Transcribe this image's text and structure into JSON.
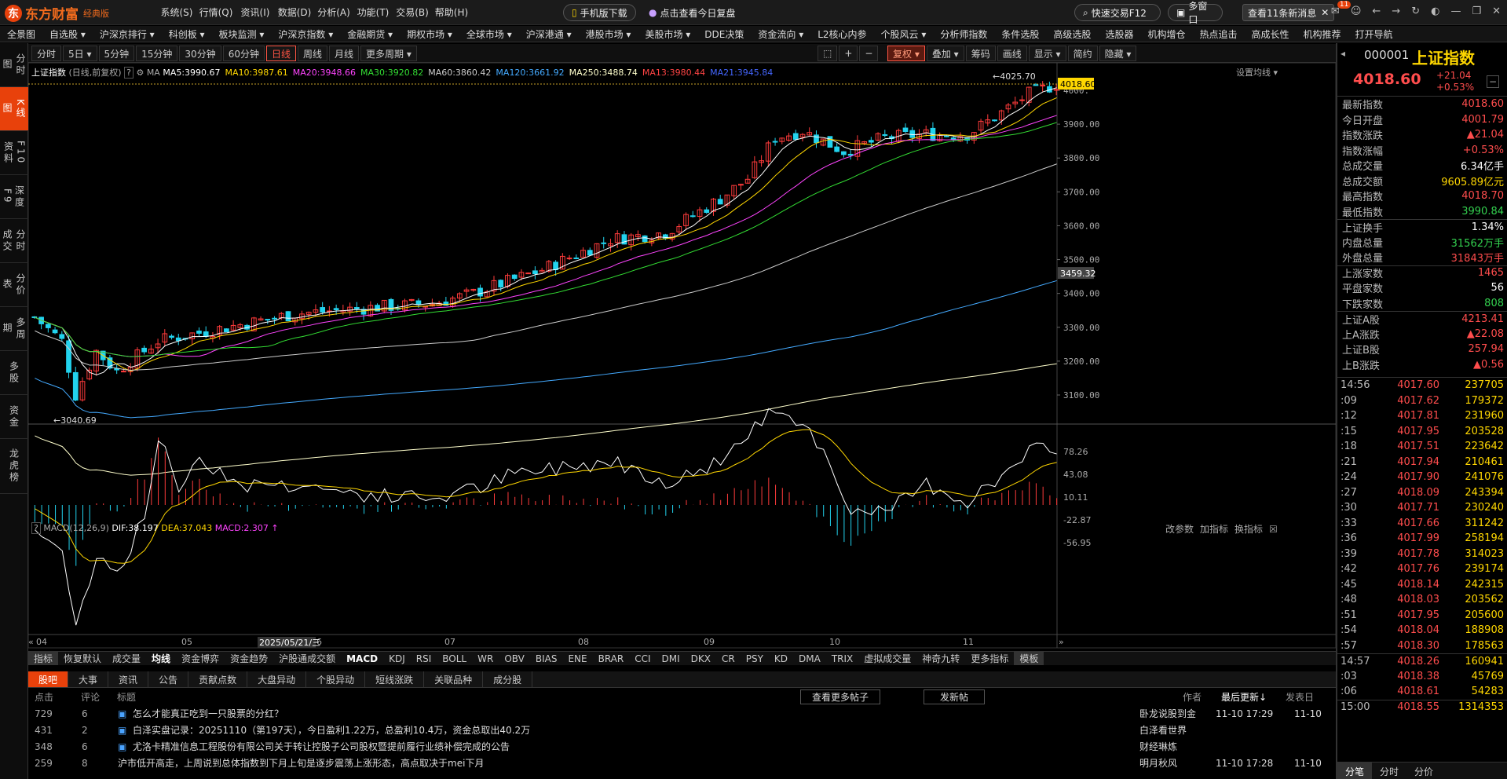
{
  "app": {
    "brand": "东方财富",
    "edition": "经典版",
    "logo_mark": "东"
  },
  "menu": [
    "系统(S)",
    "行情(Q)",
    "资讯(I)",
    "数据(D)",
    "分析(A)",
    "功能(T)",
    "交易(B)",
    "帮助(H)"
  ],
  "promo": {
    "mobile": "手机版下载",
    "review": "点击查看今日复盘"
  },
  "topright": {
    "quick_trade": "快速交易F12",
    "multi_window": "多窗口",
    "news": "查看11条新消息",
    "badge": "11"
  },
  "navbar": [
    "全景图",
    "自选股 ▾",
    "沪深京排行 ▾",
    "科创板 ▾",
    "板块监测 ▾",
    "沪深京指数 ▾",
    "金融期货 ▾",
    "期权市场 ▾",
    "全球市场 ▾",
    "沪深港通 ▾",
    "港股市场 ▾",
    "美股市场 ▾",
    "DDE决策",
    "资金流向 ▾",
    "L2核心内参",
    "个股风云 ▾",
    "分析师指数",
    "条件选股",
    "高级选股",
    "选股器",
    "机构增仓",
    "热点追击",
    "高成长性",
    "机构推荐",
    "打开导航"
  ],
  "leftbar": [
    "分时图",
    "K线图",
    "F10资料",
    "深度F9",
    "分时成交",
    "分价表",
    "多周期",
    "多股",
    "资金",
    "龙虎榜"
  ],
  "periods": [
    "分时",
    "5日 ▾",
    "5分钟",
    "15分钟",
    "30分钟",
    "60分钟",
    "日线",
    "周线",
    "月线",
    "更多周期 ▾"
  ],
  "active_period": "日线",
  "toolbar": [
    "复权 ▾",
    "叠加 ▾",
    "筹码",
    "画线",
    "显示 ▾",
    "简约",
    "隐藏 ▾"
  ],
  "chart_title": "上证指数",
  "chart_sub": "(日线,前复权)",
  "ma_legend": [
    {
      "label": "MA5:3990.67",
      "color": "#ffffff"
    },
    {
      "label": "MA10:3987.61",
      "color": "#ffd700"
    },
    {
      "label": "MA20:3948.66",
      "color": "#ff44ff"
    },
    {
      "label": "MA30:3920.82",
      "color": "#33dd33"
    },
    {
      "label": "MA60:3860.42",
      "color": "#cccccc"
    },
    {
      "label": "MA120:3661.92",
      "color": "#44aaff"
    },
    {
      "label": "MA250:3488.74",
      "color": "#ffffcc"
    },
    {
      "label": "MA13:3980.44",
      "color": "#ff4444"
    },
    {
      "label": "MA21:3945.84",
      "color": "#4466ff"
    }
  ],
  "settings_label": "设置均线 ▾",
  "price_labels": [
    "4000.",
    "3900.00",
    "3800.00",
    "3700.00",
    "3600.00",
    "3500.00",
    "3400.00",
    "3300.00",
    "3200.00",
    "3100.00"
  ],
  "last_price_tag": "4018.60",
  "mid_tag": "3459.32",
  "high_annot": "4025.70",
  "low_annot": "3040.69",
  "macd_legend": {
    "name": "MACD(12,26,9)",
    "dif": "DIF:38.197",
    "dea": "DEA:37.043",
    "macd": "MACD:2.307"
  },
  "macd_actions": [
    "改参数",
    "加指标",
    "换指标"
  ],
  "macd_labels": [
    "78.26",
    "43.08",
    "10.11",
    "-22.87",
    "-56.95"
  ],
  "xaxis": [
    "04",
    "05",
    "06",
    "07",
    "08",
    "09",
    "10",
    "11"
  ],
  "cursor_date": "2025/05/21/三",
  "indicator_tabs": [
    "指标",
    "恢复默认",
    "成交量",
    "均线",
    "资金博弈",
    "资金趋势",
    "沪股通成交额",
    "MACD",
    "KDJ",
    "RSI",
    "BOLL",
    "WR",
    "OBV",
    "BIAS",
    "ENE",
    "BRAR",
    "CCI",
    "DMI",
    "DKX",
    "CR",
    "PSY",
    "KD",
    "DMA",
    "TRIX",
    "虚拟成交量",
    "神奇九转",
    "更多指标",
    "模板"
  ],
  "bottom_tabs": [
    "股吧",
    "大事",
    "资讯",
    "公告",
    "贡献点数",
    "大盘异动",
    "个股异动",
    "短线涨跌",
    "关联品种",
    "成分股"
  ],
  "forum": {
    "headers": {
      "clicks": "点击",
      "comments": "评论",
      "title": "标题",
      "author": "作者",
      "updated": "最后更新↓",
      "posted": "发表日"
    },
    "more": "查看更多帖子",
    "post": "发新帖",
    "rows": [
      {
        "clicks": "729",
        "comments": "6",
        "title": "怎么才能真正吃到一只股票的分红？",
        "author": "卧龙说股到金",
        "updated": "11-10 17:29",
        "posted": "11-10"
      },
      {
        "clicks": "431",
        "comments": "2",
        "title": "白泽实盘记录：20251110（第197天），今日盈利1.22万，总盈利10.4万，资金总取出40.2万",
        "author": "白泽看世界",
        "updated": "",
        "posted": ""
      },
      {
        "clicks": "348",
        "comments": "6",
        "title": "尤洛卡精准信息工程股份有限公司关于转让控股子公司股权暨提前履行业绩补偿完成的公告",
        "author": "财经琳炼",
        "updated": "",
        "posted": ""
      },
      {
        "clicks": "259",
        "comments": "8",
        "title": "沪市低开高走，上周说到总体指数到下月上旬是逐步震荡上涨形态，高点取决于mei下月",
        "author": "明月秋风",
        "updated": "11-10 17:28",
        "posted": "11-10"
      }
    ]
  },
  "index": {
    "code": "000001",
    "name": "上证指数",
    "price": "4018.60",
    "change": "+21.04",
    "pct": "+0.53%"
  },
  "quotes": [
    {
      "k": "最新指数",
      "v": "4018.60",
      "c": "red"
    },
    {
      "k": "今日开盘",
      "v": "4001.79",
      "c": "red"
    },
    {
      "k": "指数涨跌",
      "v": "▲21.04",
      "c": "red"
    },
    {
      "k": "指数涨幅",
      "v": "+0.53%",
      "c": "red"
    },
    {
      "k": "总成交量",
      "v": "6.34亿手",
      "c": "wht"
    },
    {
      "k": "总成交额",
      "v": "9605.89亿元",
      "c": "yel"
    },
    {
      "k": "最高指数",
      "v": "4018.70",
      "c": "red"
    },
    {
      "k": "最低指数",
      "v": "3990.84",
      "c": "grn"
    },
    {
      "k": "上证换手",
      "v": "1.34%",
      "c": "wht"
    },
    {
      "k": "内盘总量",
      "v": "31562万手",
      "c": "grn"
    },
    {
      "k": "外盘总量",
      "v": "31843万手",
      "c": "red"
    },
    {
      "k": "上涨家数",
      "v": "1465",
      "c": "red"
    },
    {
      "k": "平盘家数",
      "v": "56",
      "c": "wht"
    },
    {
      "k": "下跌家数",
      "v": "808",
      "c": "grn"
    },
    {
      "k": "上证A股",
      "v": "4213.41",
      "c": "red"
    },
    {
      "k": "上A涨跌",
      "v": "▲22.08",
      "c": "red"
    },
    {
      "k": "上证B股",
      "v": "257.94",
      "c": "red"
    },
    {
      "k": "上B涨跌",
      "v": "▲0.56",
      "c": "red"
    }
  ],
  "ticks": [
    {
      "t": "14:56",
      "p": "4017.60",
      "v": "237705"
    },
    {
      "t": ":09",
      "p": "4017.62",
      "v": "179372"
    },
    {
      "t": ":12",
      "p": "4017.81",
      "v": "231960"
    },
    {
      "t": ":15",
      "p": "4017.95",
      "v": "203528"
    },
    {
      "t": ":18",
      "p": "4017.51",
      "v": "223642"
    },
    {
      "t": ":21",
      "p": "4017.94",
      "v": "210461"
    },
    {
      "t": ":24",
      "p": "4017.90",
      "v": "241076"
    },
    {
      "t": ":27",
      "p": "4018.09",
      "v": "243394"
    },
    {
      "t": ":30",
      "p": "4017.71",
      "v": "230240"
    },
    {
      "t": ":33",
      "p": "4017.66",
      "v": "311242"
    },
    {
      "t": ":36",
      "p": "4017.99",
      "v": "258194"
    },
    {
      "t": ":39",
      "p": "4017.78",
      "v": "314023"
    },
    {
      "t": ":42",
      "p": "4017.76",
      "v": "239174"
    },
    {
      "t": ":45",
      "p": "4018.14",
      "v": "242315"
    },
    {
      "t": ":48",
      "p": "4018.03",
      "v": "203562"
    },
    {
      "t": ":51",
      "p": "4017.95",
      "v": "205600"
    },
    {
      "t": ":54",
      "p": "4018.04",
      "v": "188908"
    },
    {
      "t": ":57",
      "p": "4018.30",
      "v": "178563"
    },
    {
      "t": "14:57",
      "p": "4018.26",
      "v": "160941"
    },
    {
      "t": ":03",
      "p": "4018.38",
      "v": "45769"
    },
    {
      "t": ":06",
      "p": "4018.61",
      "v": "54283"
    },
    {
      "t": "15:00",
      "p": "4018.55",
      "v": "1314353"
    }
  ],
  "right_tabs": [
    "分笔",
    "分时",
    "分价"
  ]
}
